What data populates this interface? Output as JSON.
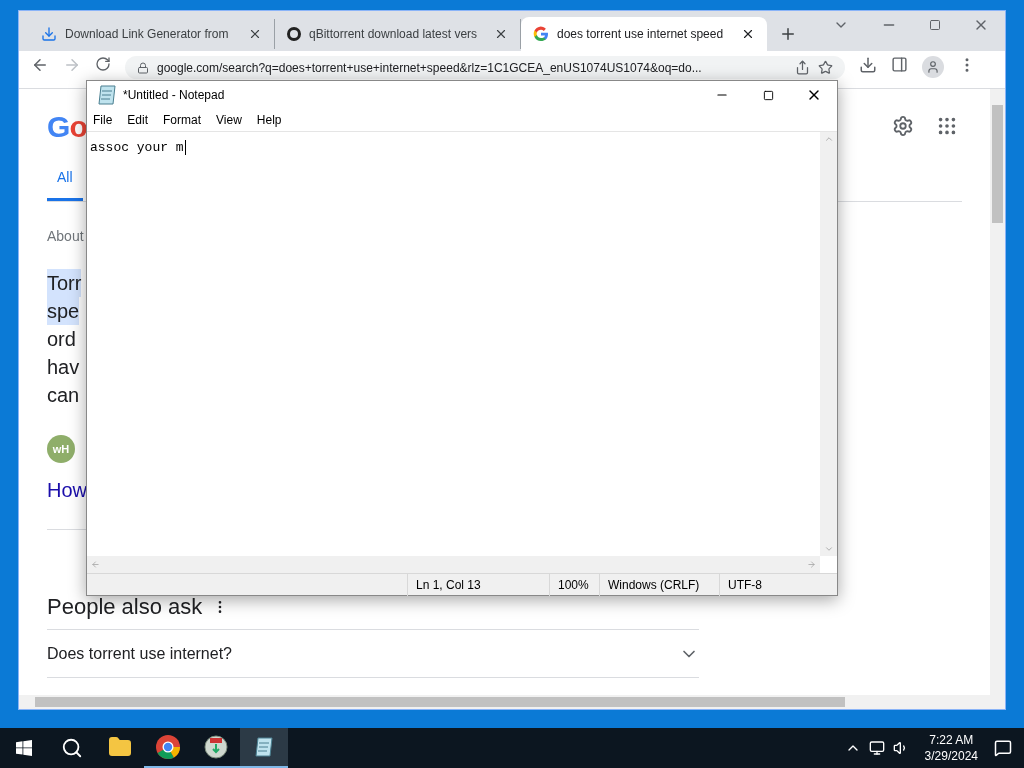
{
  "browser": {
    "tabs": [
      {
        "title": "Download Link Generator from",
        "kind": "download",
        "selected": false
      },
      {
        "title": "qBittorrent download latest vers",
        "kind": "ring",
        "selected": false
      },
      {
        "title": "does torrent use internet speed",
        "kind": "google",
        "selected": true
      }
    ],
    "address": "google.com/search?q=does+torrent+use+internet+speed&rlz=1C1GCEA_enUS1074US1074&oq=do...",
    "page": {
      "logo": "Go",
      "search_tabs": [
        {
          "label": "All",
          "selected": true
        }
      ],
      "about": "About",
      "snippet_lines": [
        {
          "text": "Torr",
          "highlighted": true
        },
        {
          "text": "spe",
          "highlighted": true
        },
        {
          "text": "ord",
          "highlighted": false
        },
        {
          "text": "hav",
          "highlighted": false
        },
        {
          "text": "can",
          "highlighted": false
        }
      ],
      "source_badge": "wH",
      "result_link": "How",
      "people_also_ask": {
        "heading": "People also ask",
        "questions": [
          {
            "text": "Does torrent use internet?",
            "expanded": false
          }
        ]
      }
    }
  },
  "notepad": {
    "title": "*Untitled - Notepad",
    "menu": [
      "File",
      "Edit",
      "Format",
      "View",
      "Help"
    ],
    "text": "assoc your m",
    "status": [
      "Ln 1, Col 13",
      "100%",
      "Windows (CRLF)",
      "UTF-8"
    ]
  },
  "taskbar": {
    "apps": [
      {
        "kind": "explorer",
        "running": false,
        "selected": false
      },
      {
        "kind": "chrome",
        "running": true,
        "selected": false
      },
      {
        "kind": "installer",
        "running": true,
        "selected": false
      },
      {
        "kind": "notepad",
        "running": true,
        "selected": true
      }
    ],
    "time": "7:22 AM",
    "date": "3/29/2024"
  }
}
